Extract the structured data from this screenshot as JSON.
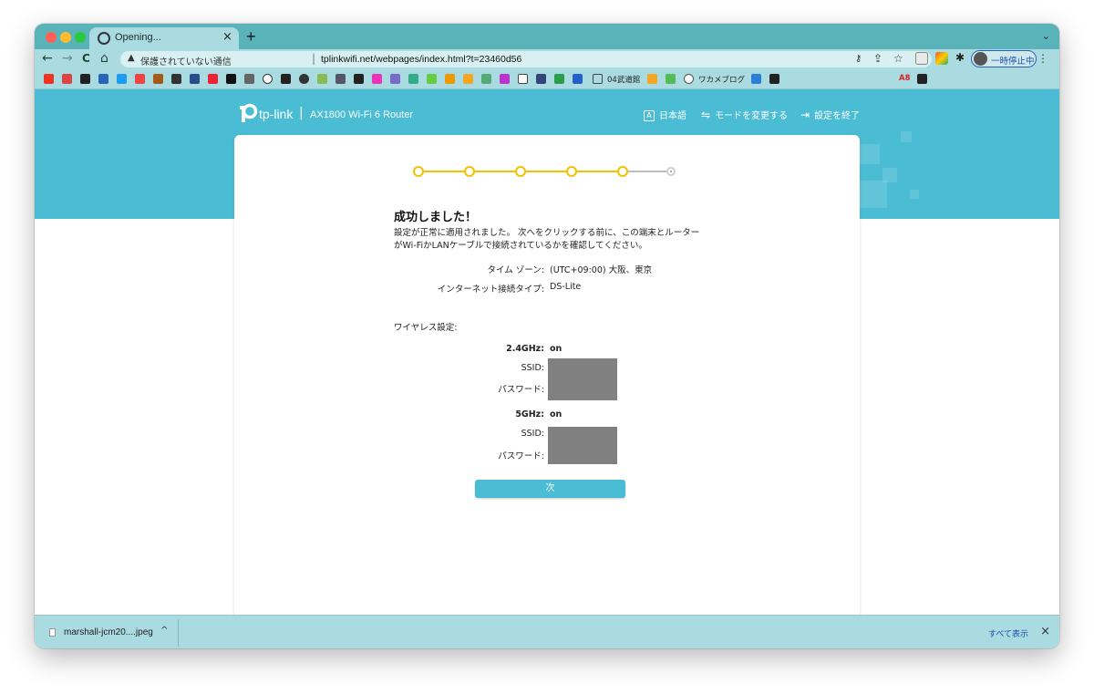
{
  "browser": {
    "tab_title": "Opening...",
    "tab_close": "×",
    "new_tab": "+",
    "tabs_menu": "⌄",
    "nav": {
      "back": "←",
      "forward": "→",
      "reload": "C",
      "home": "⌂"
    },
    "security_text": "保護されていない通信",
    "url": "tplinkwifi.net/webpages/index.html?t=23460d56",
    "url_separator": "|",
    "profile_label": "一時停止中",
    "menu": "⋮",
    "bookmark_label_1": "04武道館",
    "bookmark_label_2": "ワカメブログ",
    "bookmark_label_3": "A8"
  },
  "header": {
    "logo_text": "tp-link",
    "logo_separator": "|",
    "model": "AX1800 Wi-Fi 6 Router",
    "language_icon": "A",
    "language": "日本語",
    "change_mode": "モードを変更する",
    "exit_setup": "設定を終了"
  },
  "wizard": {
    "steps_total": 6,
    "steps_completed": 5,
    "heading": "成功しました！",
    "message": "設定が正常に適用されました。 次へをクリックする前に、この端末とルーターがWi-FiかLANケーブルで接続されているかを確認してください。",
    "timezone_label": "タイム ゾーン:",
    "timezone_value": "(UTC+09:00) 大阪、東京",
    "conn_type_label": "インターネット接続タイプ:",
    "conn_type_value": "DS-Lite",
    "wireless_heading": "ワイヤレス設定:",
    "band24_label": "2.4GHz:",
    "band24_value": "on",
    "band5_label": "5GHz:",
    "band5_value": "on",
    "ssid_label": "SSID:",
    "password_label": "パスワード:",
    "next_button": "次"
  },
  "downloads": {
    "file_name": "marshall-jcm20....jpeg",
    "chevron": "^",
    "show_all": "すべて表示",
    "close": "×"
  },
  "colors": {
    "accent": "#4abcd3",
    "step_done": "#f4c100",
    "chrome": "#a9dbe0",
    "mask": "#808080"
  }
}
